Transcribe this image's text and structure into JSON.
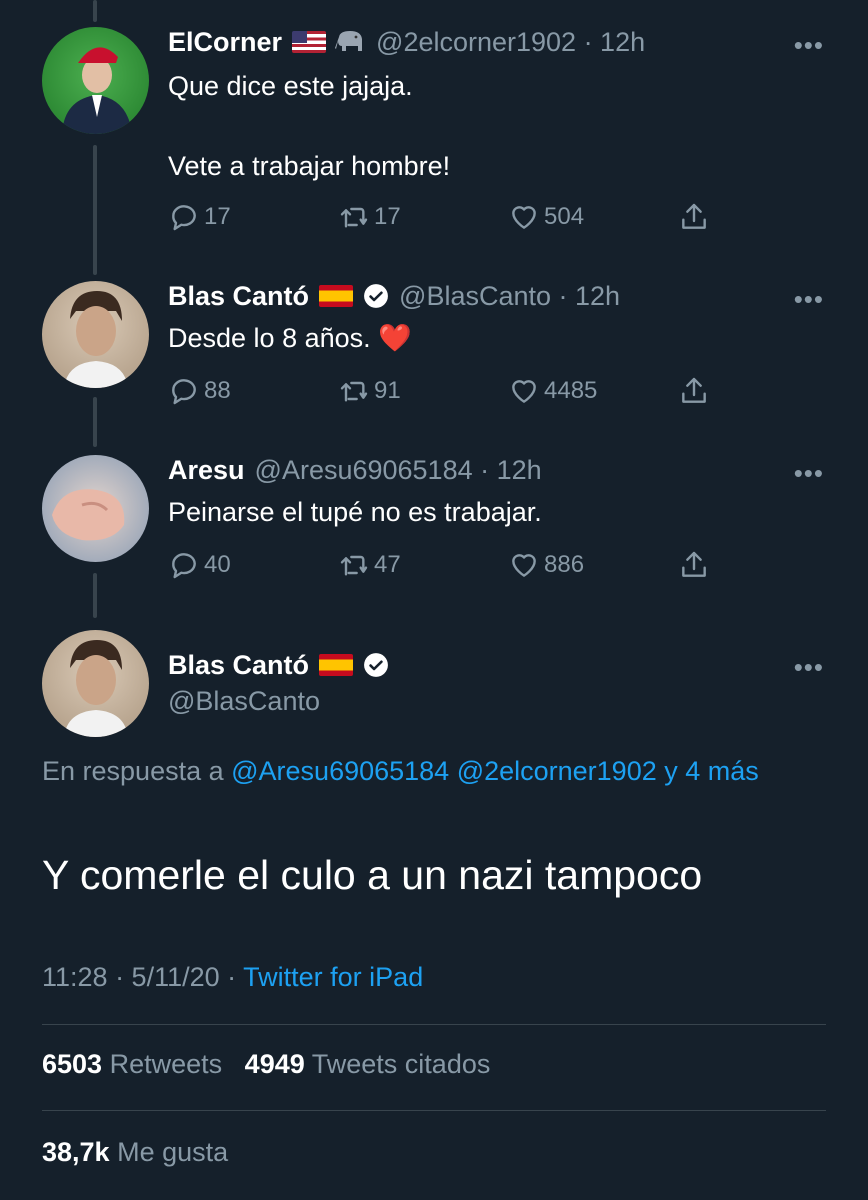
{
  "tweets": [
    {
      "name": "ElCorner",
      "handle": "@2elcorner1902 · 12h",
      "text": "Que dice este jajaja.\n\nVete a trabajar hombre!",
      "replies": "17",
      "retweets": "17",
      "likes": "504"
    },
    {
      "name": "Blas Cantó",
      "handle": "@BlasCanto · 12h",
      "text": "Desde lo 8 años. ❤️",
      "replies": "88",
      "retweets": "91",
      "likes": "4485"
    },
    {
      "name": "Aresu",
      "handle": "@Aresu69065184 · 12h",
      "text": "Peinarse el tupé no es trabajar.",
      "replies": "40",
      "retweets": "47",
      "likes": "886"
    }
  ],
  "main_tweet": {
    "name": "Blas Cantó",
    "handle": "@BlasCanto",
    "reply_prefix": "En respuesta a ",
    "reply_mentions": "@Aresu69065184 @2elcorner1902 y 4 más",
    "text": "Y comerle el culo a un nazi tampoco",
    "timestamp": "11:28 · 5/11/20 · ",
    "source": "Twitter for iPad",
    "retweet_count": "6503",
    "retweet_label": "Retweets",
    "quote_count": "4949",
    "quote_label": "Tweets citados",
    "like_count": "38,7k",
    "like_label": "Me gusta"
  },
  "more_label": "•••",
  "colors": {
    "background": "#15202b",
    "secondary_text": "#8899a6",
    "link": "#1da1f2",
    "divider": "#38444d"
  }
}
